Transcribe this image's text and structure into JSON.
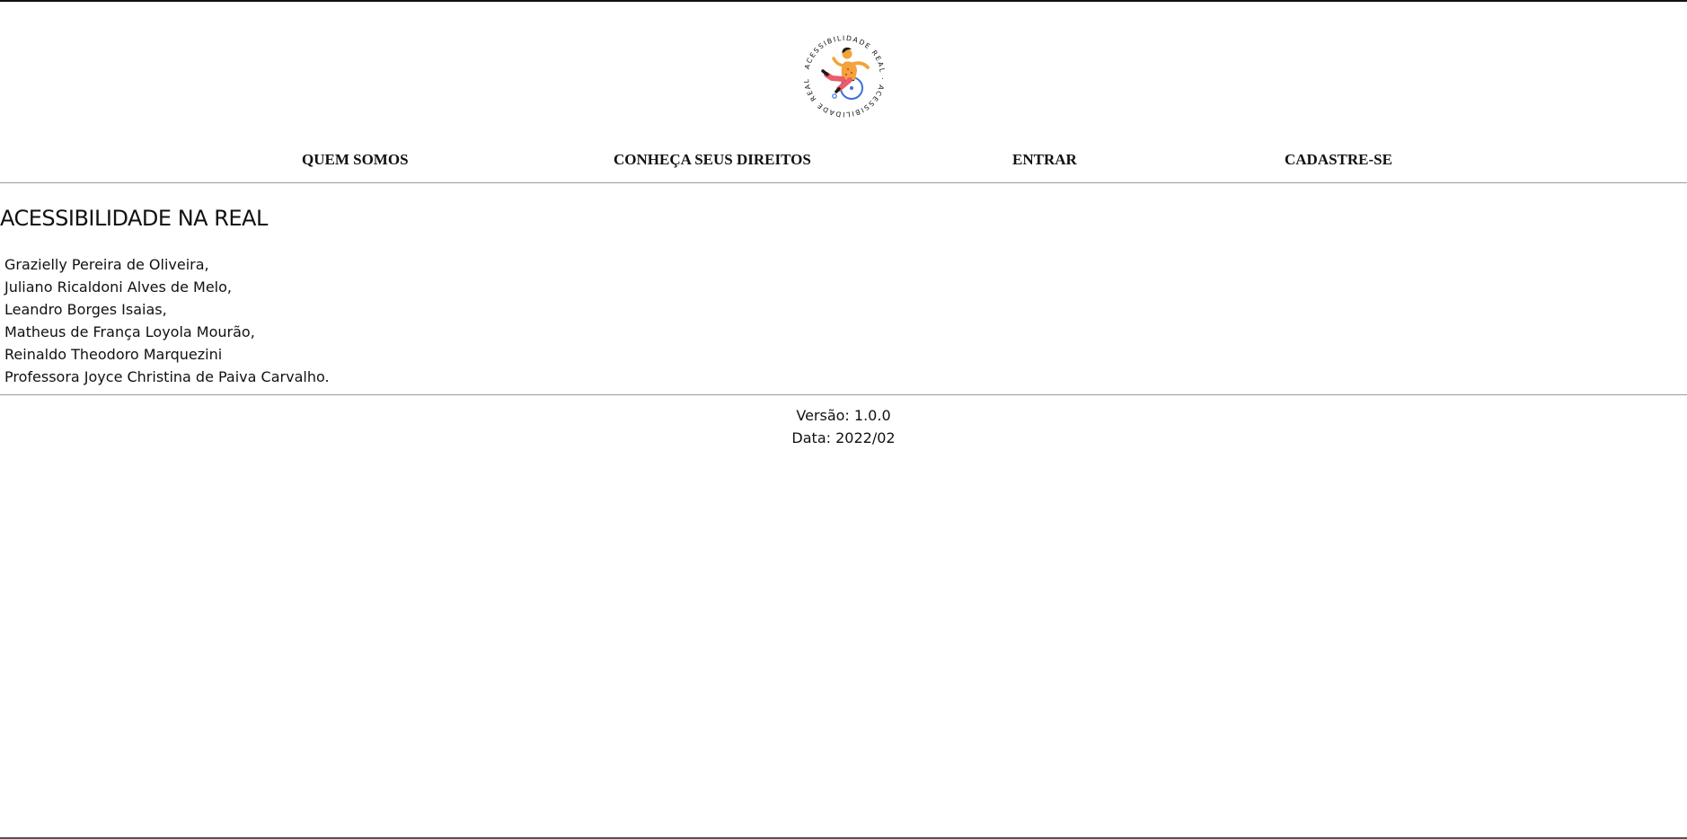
{
  "logo": {
    "ring_text": "ACESSIBILIDADE REAL · ACESSIBILIDADE REAL ·",
    "icon": "wheelchair-person-logo",
    "colors": {
      "skin": "#f2a33a",
      "shirt": "#f4a23c",
      "pants": "#ec5a6b",
      "wheel": "#3d6fe0",
      "hair": "#1a1a1a"
    }
  },
  "nav": {
    "items": [
      {
        "label": "QUEM SOMOS"
      },
      {
        "label": "CONHEÇA SEUS DIREITOS"
      },
      {
        "label": "ENTRAR"
      },
      {
        "label": "CADASTRE-SE"
      }
    ]
  },
  "main": {
    "title": "ACESSIBILIDADE NA REAL",
    "authors": [
      "Grazielly Pereira de Oliveira,",
      "Juliano Ricaldoni Alves de Melo,",
      "Leandro Borges Isaias,",
      "Matheus de França Loyola Mourão,",
      "Reinaldo Theodoro Marquezini",
      "Professora Joyce Christina de Paiva Carvalho."
    ]
  },
  "footer": {
    "version": "Versão: 1.0.0",
    "date": "Data: 2022/02"
  }
}
